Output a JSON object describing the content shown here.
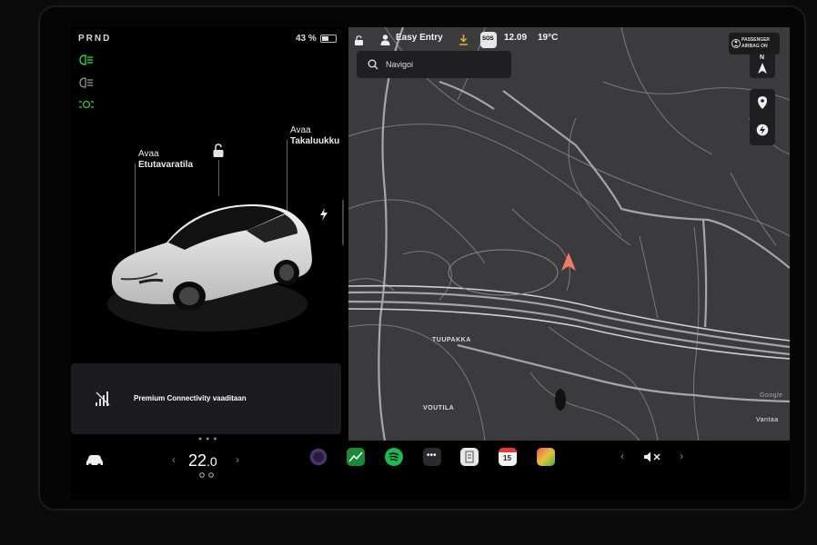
{
  "status": {
    "gear": "PRND",
    "battery": "43 %",
    "profile": "Easy Entry",
    "sos": "SOS",
    "time": "12.09",
    "outside_temp": "19°C",
    "airbag_line1": "PASSENGER",
    "airbag_line2": "AIRBAG ON"
  },
  "car_view": {
    "frunk_line1": "Avaa",
    "frunk_line2": "Etutavaratila",
    "trunk_line1": "Avaa",
    "trunk_line2": "Takaluukku"
  },
  "notice": {
    "text": "Premium Connectivity vaaditaan"
  },
  "map": {
    "search_placeholder": "Navigoi",
    "compass": "N",
    "labels": [
      "TUUPAKKA",
      "VOUTILA"
    ],
    "city": "Vantaa",
    "brand": "Google"
  },
  "dock": {
    "cabin_temp": "22",
    "cabin_temp_decimal": ".0",
    "calendar_day": "15"
  },
  "colors": {
    "light_green": "#2ecc40",
    "nav_arrow": "#f07a6a",
    "download_orange": "#e8a23a"
  }
}
